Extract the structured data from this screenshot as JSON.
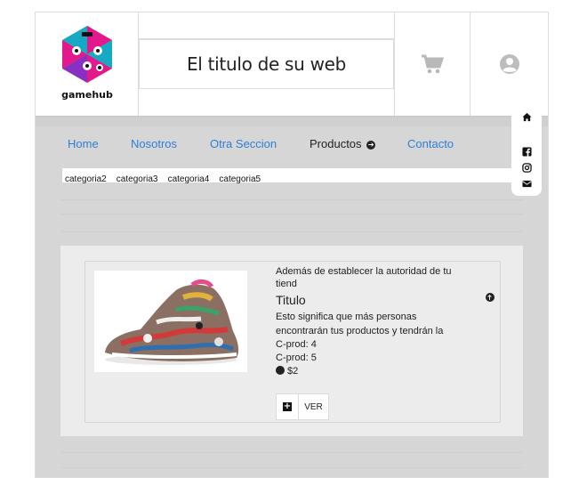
{
  "header": {
    "logo_text": "gamehub",
    "site_title": "El titulo de su web"
  },
  "nav": {
    "items": [
      {
        "label": "Home"
      },
      {
        "label": "Nosotros"
      },
      {
        "label": "Otra Seccion"
      },
      {
        "label": "Productos"
      },
      {
        "label": "Contacto"
      }
    ]
  },
  "categories": [
    "categoria2",
    "categoria3",
    "categoria4",
    "categoria5"
  ],
  "social": [
    "home-icon",
    "facebook-icon",
    "instagram-icon",
    "mail-icon"
  ],
  "product": {
    "intro": "Además de establecer la autoridad de tu tiend",
    "title": "Titulo",
    "description": "Esto significa que más personas encontrarán tus productos y tendrán la",
    "cprod_1": "C-prod: 4",
    "cprod_2": "C-prod: 5",
    "price": "$2",
    "add_label": "+",
    "ver_label": "VER"
  },
  "colors": {
    "link": "#2e7fd6",
    "page_bg": "#d6d6d6",
    "card_bg": "#ececec"
  }
}
